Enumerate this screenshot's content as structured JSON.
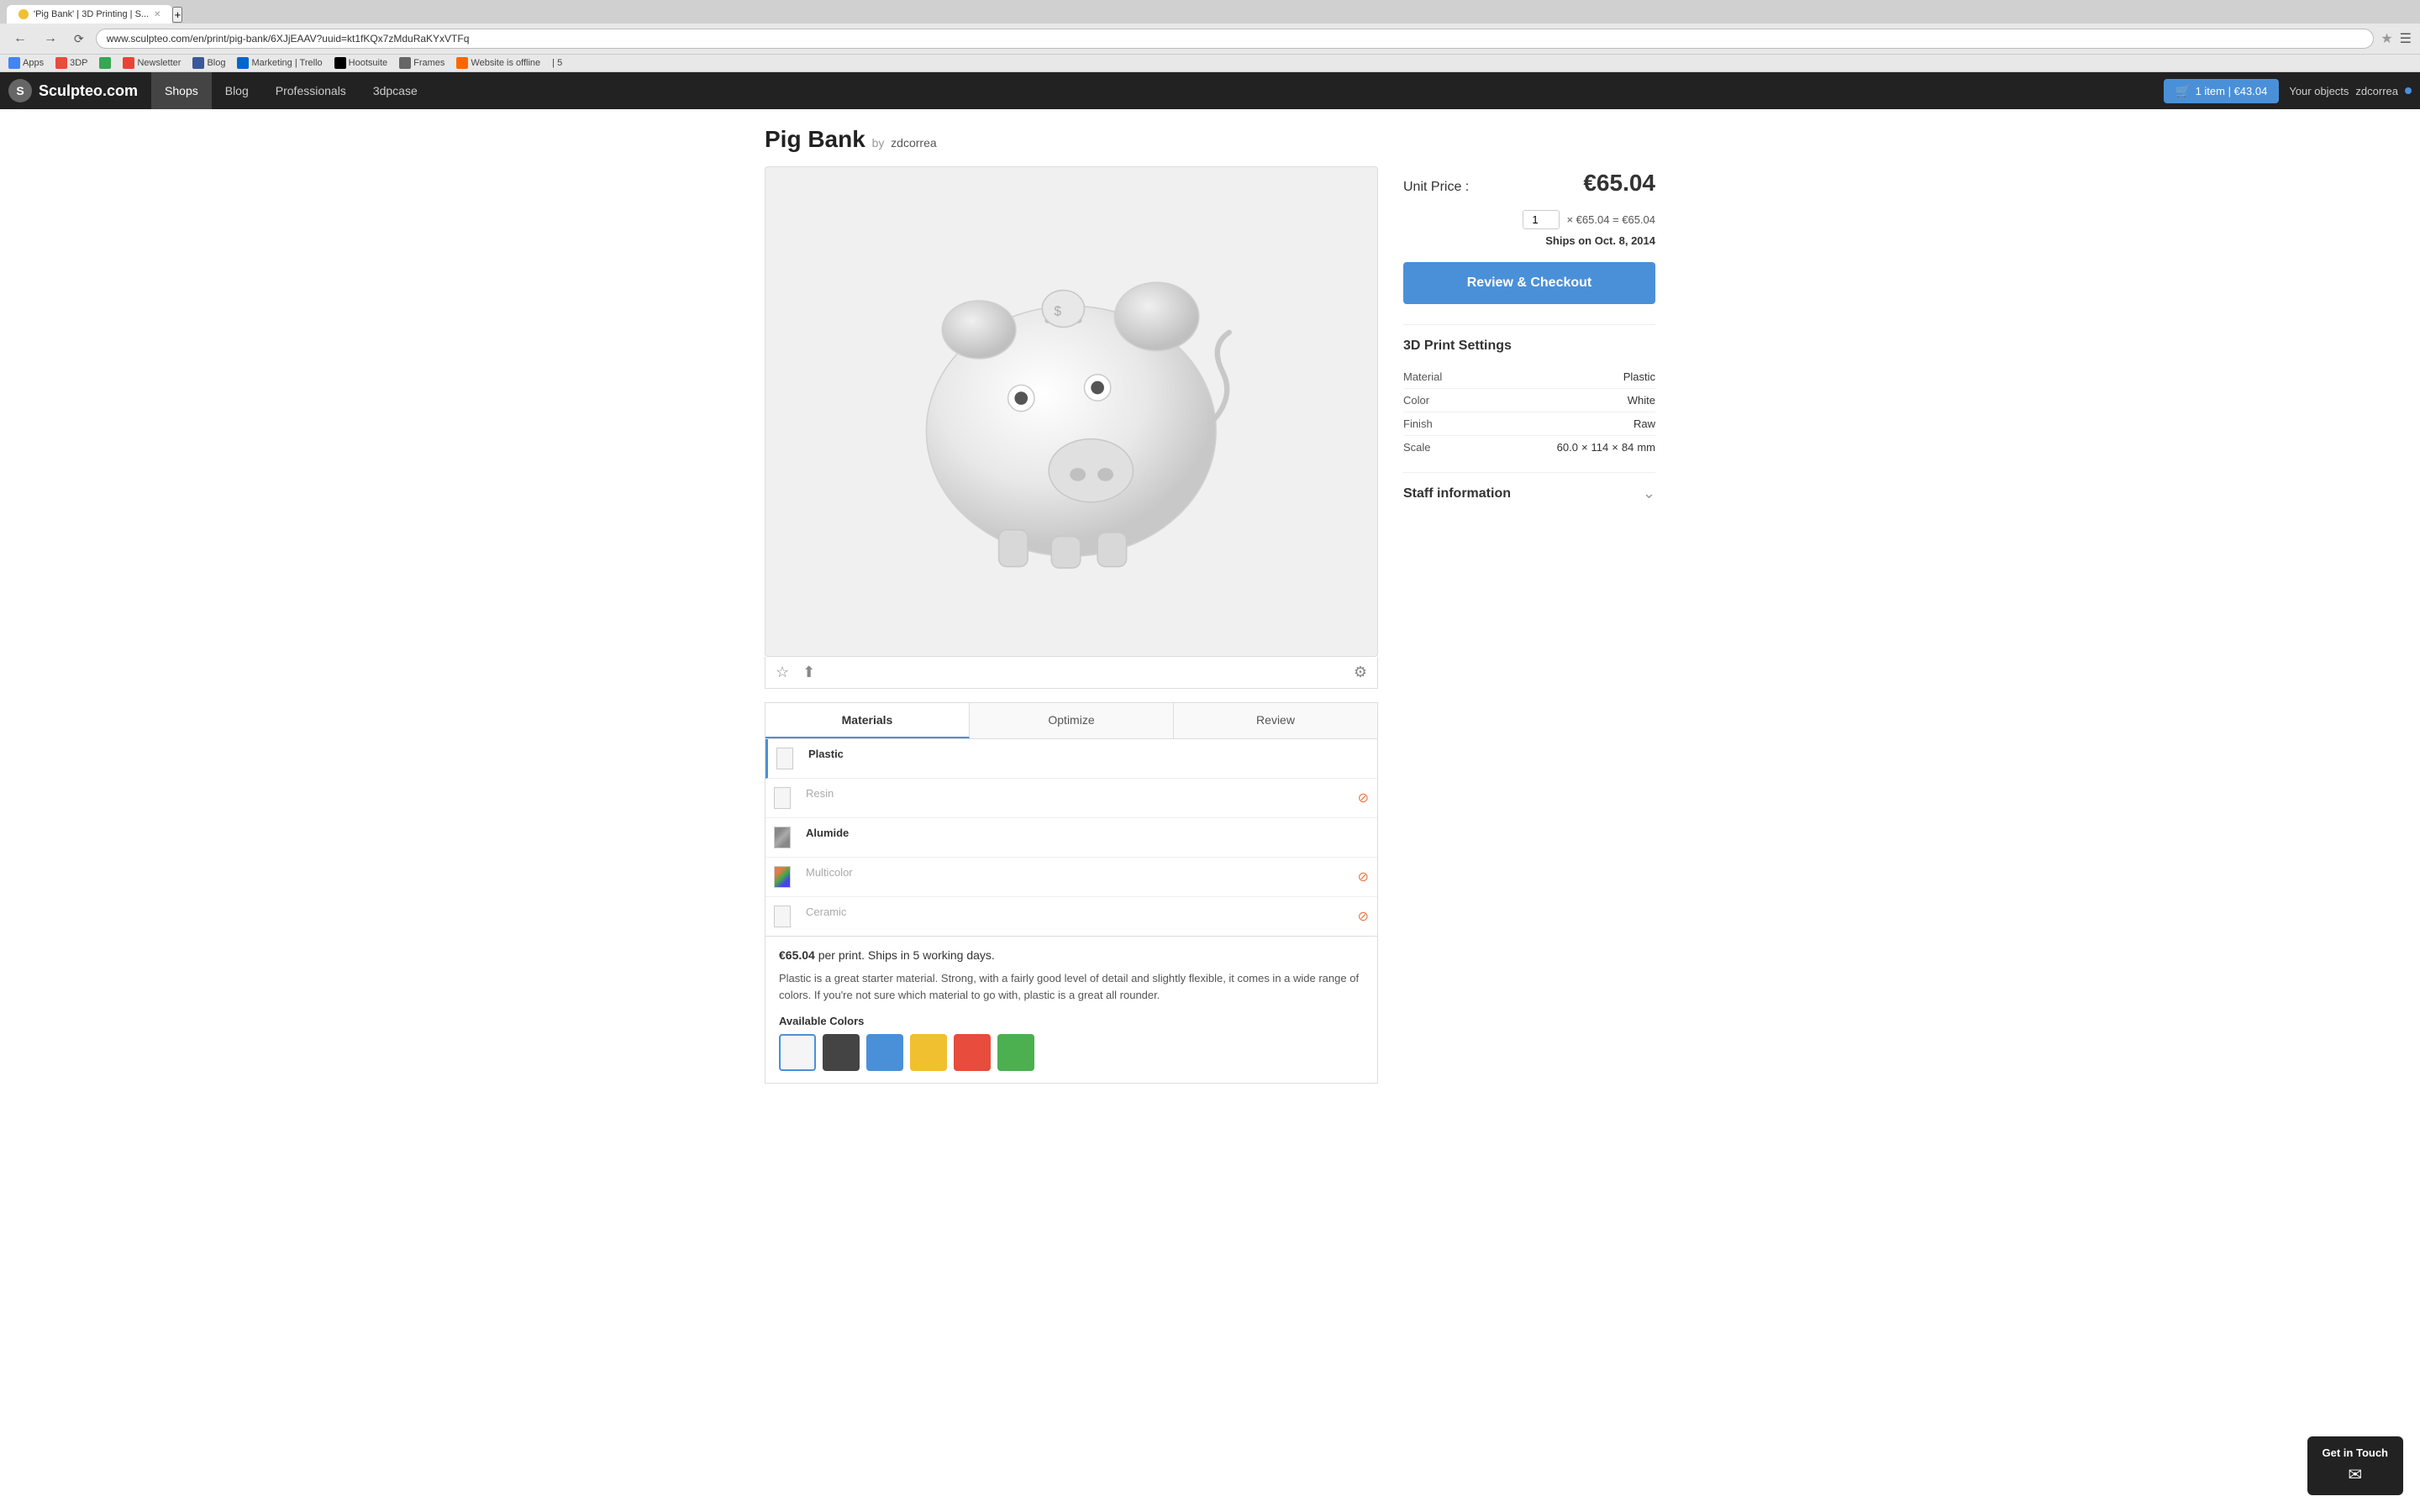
{
  "browser": {
    "tab_title": "'Pig Bank' | 3D Printing | S...",
    "url": "www.sculpteo.com/en/print/pig-bank/6XJjEAAV?uuid=kt1fKQx7zMduRaKYxVTFq",
    "bookmarks": [
      {
        "label": "Apps",
        "icon": "apps"
      },
      {
        "label": "3DP",
        "icon": "rdp"
      },
      {
        "label": "",
        "icon": "drive"
      },
      {
        "label": "Newsletter",
        "icon": "news"
      },
      {
        "label": "Blog",
        "icon": "blog"
      },
      {
        "label": "Marketing | Trello",
        "icon": "marketing"
      },
      {
        "label": "",
        "icon": "hootsuite"
      },
      {
        "label": "Hootsuite",
        "icon": "hootsuite"
      },
      {
        "label": "Frames",
        "icon": "frames"
      },
      {
        "label": "Website is offline",
        "icon": "website"
      },
      {
        "label": "5",
        "icon": "none"
      }
    ]
  },
  "nav": {
    "logo_text": "Sculpteo.com",
    "links": [
      "Shops",
      "Blog",
      "Professionals",
      "3dpcase"
    ],
    "active_link": "Shops",
    "cart_label": "1 item | €43.04",
    "your_objects": "Your objects",
    "username": "zdcorrea"
  },
  "page": {
    "title": "Pig Bank",
    "by_label": "by",
    "author": "zdcorrea"
  },
  "pricing": {
    "unit_price_label": "Unit Price :",
    "unit_price": "€65.04",
    "quantity": "1",
    "per_unit": "× €65.04 = €65.04",
    "ships_label": "Ships on Oct. 8, 2014",
    "checkout_btn": "Review & Checkout"
  },
  "print_settings": {
    "title": "3D Print Settings",
    "rows": [
      {
        "label": "Material",
        "value": "Plastic"
      },
      {
        "label": "Color",
        "value": "White"
      },
      {
        "label": "Finish",
        "value": "Raw"
      },
      {
        "label": "Scale",
        "value": ""
      }
    ],
    "scale": {
      "x": "60.0",
      "sep1": "×",
      "y": "114",
      "sep2": "×",
      "z": "84",
      "unit": "mm"
    }
  },
  "staff": {
    "title": "Staff information"
  },
  "tabs": [
    "Materials",
    "Optimize",
    "Review"
  ],
  "active_tab": "Materials",
  "materials": [
    {
      "name": "Plastic",
      "available": true,
      "selected": true,
      "swatch": "white"
    },
    {
      "name": "Resin",
      "available": false,
      "swatch": "white"
    },
    {
      "name": "Alumide",
      "available": true,
      "swatch": "alumide"
    },
    {
      "name": "Multicolor",
      "available": false,
      "swatch": "multicolor"
    },
    {
      "name": "Ceramic",
      "available": false,
      "swatch": "white"
    }
  ],
  "material_desc": {
    "price": "€65.04",
    "per_print": "per print. Ships in 5 working days.",
    "description": "Plastic is a great starter material. Strong, with a fairly good level of detail and slightly flexible, it comes in a wide range of colors. If you're not sure which material to go with, plastic is a great all rounder.",
    "colors_title": "Available Colors",
    "colors": [
      {
        "name": "white",
        "class": "white-swatch",
        "selected": true
      },
      {
        "name": "dark",
        "class": "dark"
      },
      {
        "name": "blue",
        "class": "blue"
      },
      {
        "name": "yellow",
        "class": "yellow"
      },
      {
        "name": "red",
        "class": "red"
      },
      {
        "name": "green",
        "class": "green"
      }
    ]
  },
  "get_in_touch": {
    "title": "Get in Touch",
    "icon": "✉"
  }
}
